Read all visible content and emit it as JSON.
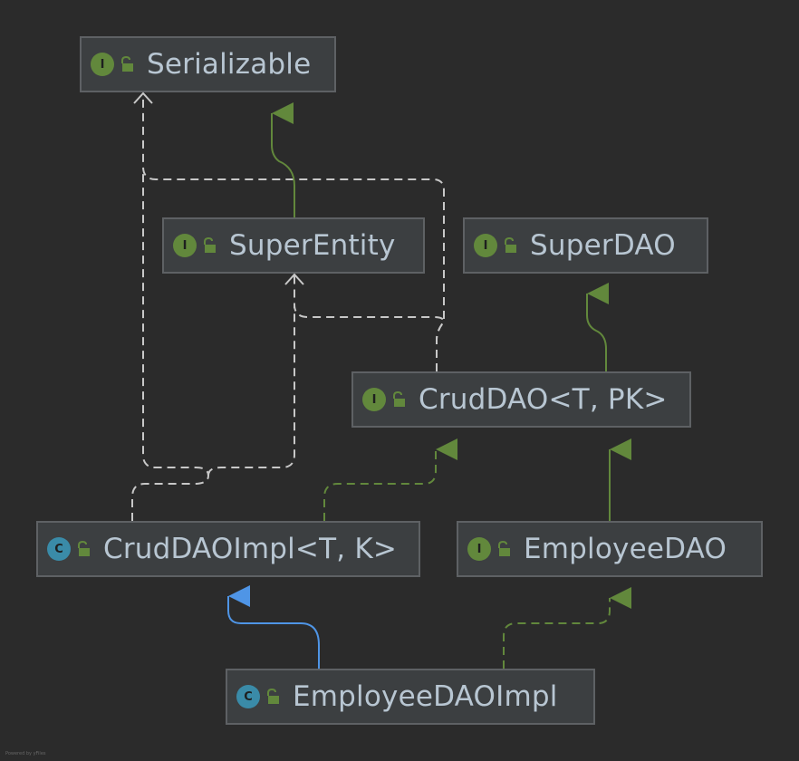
{
  "nodes": {
    "serializable": {
      "name": "Serializable",
      "kind": "I",
      "kind_type": "interface"
    },
    "super_entity": {
      "name": "SuperEntity",
      "kind": "I",
      "kind_type": "interface"
    },
    "super_dao": {
      "name": "SuperDAO",
      "kind": "I",
      "kind_type": "interface"
    },
    "crud_dao": {
      "name": "CrudDAO<T, PK>",
      "kind": "I",
      "kind_type": "interface"
    },
    "crud_dao_impl": {
      "name": "CrudDAOImpl<T, K>",
      "kind": "C",
      "kind_type": "class"
    },
    "employee_dao": {
      "name": "EmployeeDAO",
      "kind": "I",
      "kind_type": "interface"
    },
    "employee_dao_impl": {
      "name": "EmployeeDAOImpl",
      "kind": "C",
      "kind_type": "class"
    }
  },
  "relations": [
    {
      "from": "super_entity",
      "to": "serializable",
      "type": "extends"
    },
    {
      "from": "crud_dao",
      "to": "serializable",
      "type": "uses"
    },
    {
      "from": "crud_dao",
      "to": "super_entity",
      "type": "uses"
    },
    {
      "from": "crud_dao",
      "to": "super_dao",
      "type": "extends"
    },
    {
      "from": "crud_dao_impl",
      "to": "crud_dao",
      "type": "implements"
    },
    {
      "from": "crud_dao_impl",
      "to": "serializable",
      "type": "uses"
    },
    {
      "from": "crud_dao_impl",
      "to": "super_entity",
      "type": "uses"
    },
    {
      "from": "employee_dao",
      "to": "crud_dao",
      "type": "extends"
    },
    {
      "from": "employee_dao_impl",
      "to": "crud_dao_impl",
      "type": "extends"
    },
    {
      "from": "employee_dao_impl",
      "to": "employee_dao",
      "type": "implements"
    }
  ],
  "colors": {
    "background": "#2b2b2b",
    "node_fill": "#3c3f41",
    "node_border": "#5e6164",
    "interface_extends": "#62883c",
    "class_extends": "#4f95e6",
    "dependency": "#c8c8c8",
    "badge_interface": "#62883c",
    "badge_class": "#3a8ba8"
  },
  "footer": "Powered by yFiles"
}
